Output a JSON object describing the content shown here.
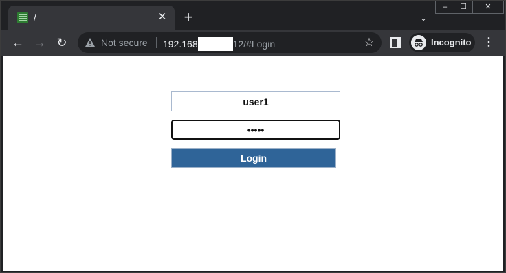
{
  "tab": {
    "title": "/",
    "close_glyph": "✕",
    "favicon": "spreadsheet-favicon-icon"
  },
  "tabbar": {
    "new_tab_glyph": "+",
    "search_tabs_glyph": "⌄"
  },
  "window_controls": {
    "minimize": "–",
    "maximize": "☐",
    "close": "✕"
  },
  "nav": {
    "back_glyph": "←",
    "forward_glyph": "→",
    "reload_glyph": "↻"
  },
  "omnibox": {
    "security_label": "Not secure",
    "url_host": "192.168",
    "url_path": "12/#Login"
  },
  "toolbar": {
    "star_glyph": "☆",
    "incognito_label": "Incognito",
    "menu_glyph": "⋮"
  },
  "login": {
    "username_value": "user1",
    "password_value": "•••••",
    "button_label": "Login"
  },
  "colors": {
    "accent": "#2f6498",
    "chrome_dark": "#202124",
    "chrome_toolbar": "#35363a"
  }
}
